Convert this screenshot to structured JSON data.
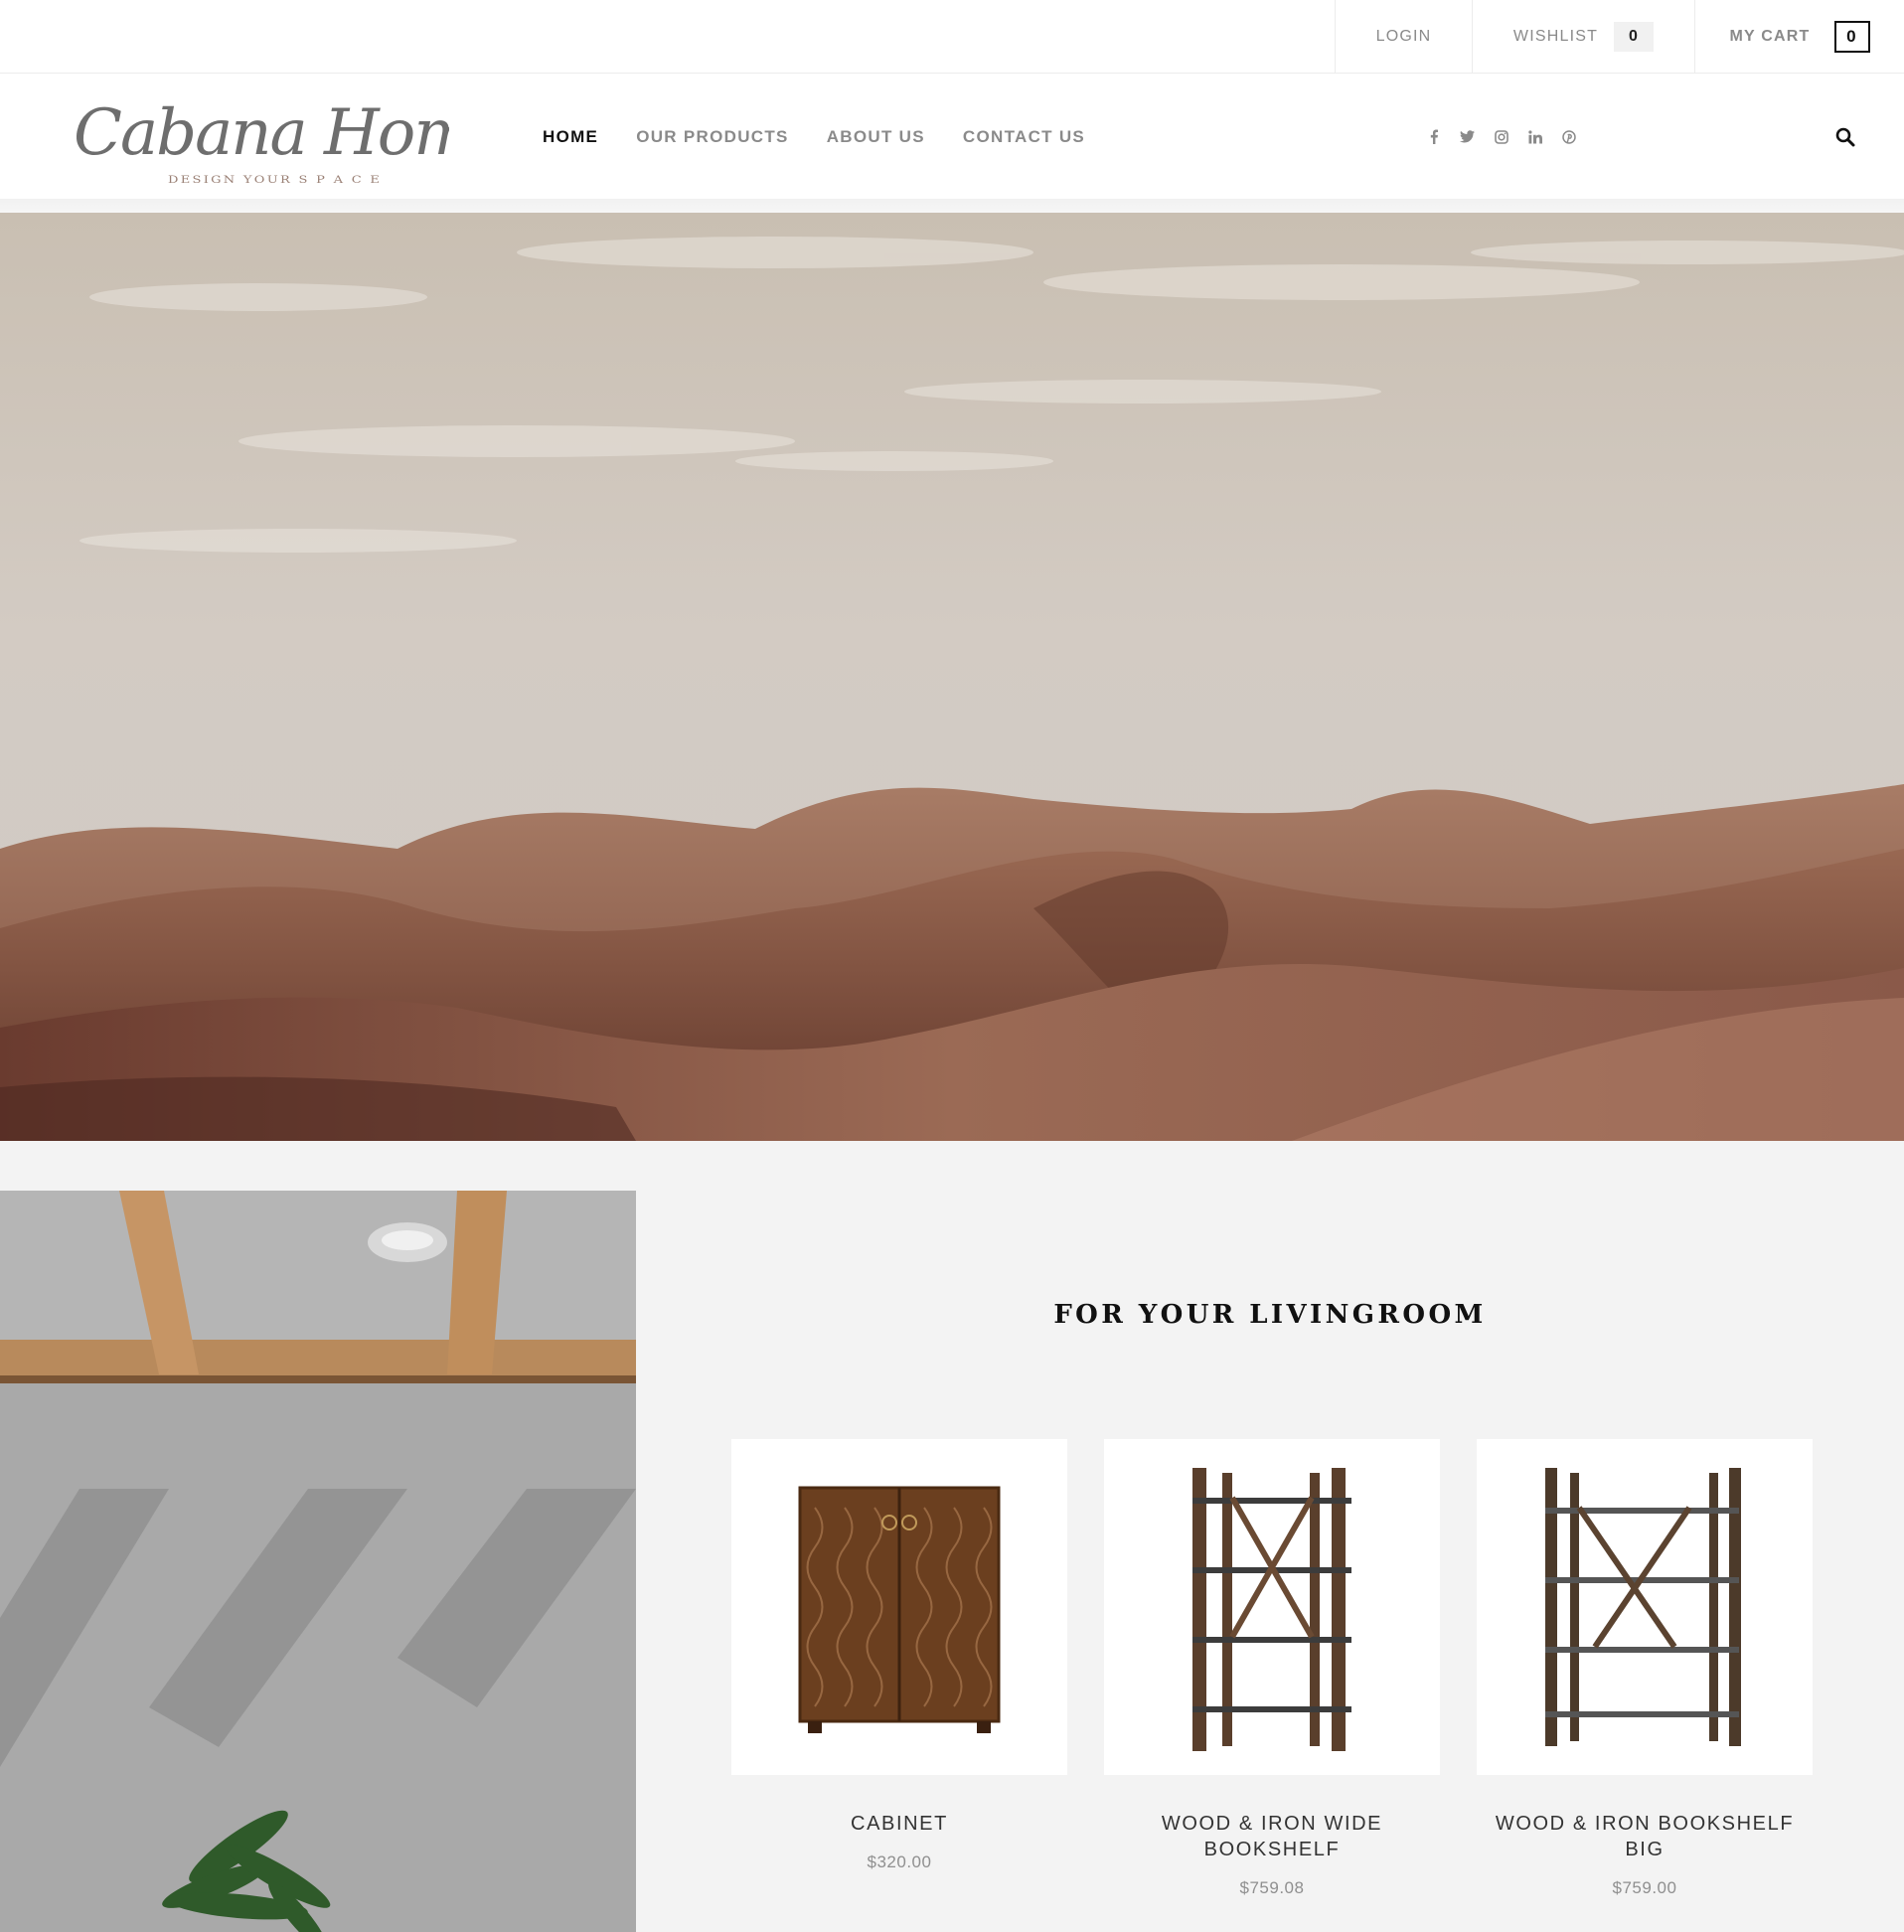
{
  "topbar": {
    "login_label": "LOGIN",
    "wishlist_label": "WISHLIST",
    "wishlist_count": "0",
    "cart_label": "MY CART",
    "cart_count": "0"
  },
  "brand": {
    "name": "Cabana Home",
    "tagline": "DESIGN YOUR S P A C E"
  },
  "nav": {
    "items": [
      {
        "label": "HOME",
        "active": true
      },
      {
        "label": "OUR PRODUCTS"
      },
      {
        "label": "ABOUT US"
      },
      {
        "label": "CONTACT US"
      }
    ]
  },
  "social": [
    "facebook-icon",
    "twitter-icon",
    "instagram-icon",
    "linkedin-icon",
    "pinterest-icon"
  ],
  "section": {
    "title": "FOR YOUR LIVINGROOM",
    "products": [
      {
        "name": "CABINET",
        "price": "$320.00"
      },
      {
        "name": "WOOD & IRON WIDE BOOKSHELF",
        "price": "$759.08"
      },
      {
        "name": "WOOD & IRON BOOKSHELF BIG",
        "price": "$759.00"
      }
    ]
  },
  "colors": {
    "accent_text": "#111111",
    "muted_text": "#8a8a8a",
    "section_bg": "#f3f3f3",
    "dune": "#8f5f4c"
  }
}
